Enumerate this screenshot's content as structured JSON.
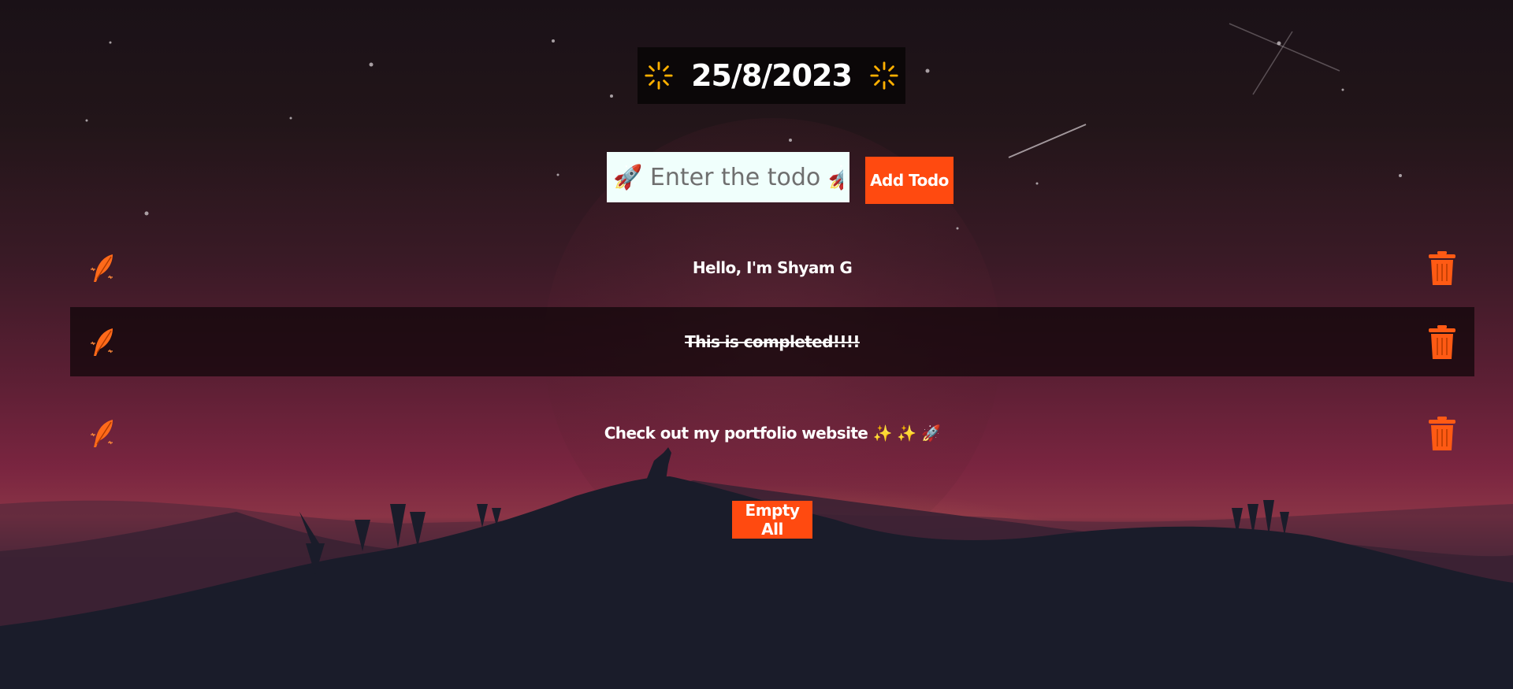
{
  "header": {
    "date": "25/8/2023",
    "left_icon": "sparkle-icon",
    "right_icon": "sparkle-icon"
  },
  "input": {
    "placeholder": "🚀 Enter the todo 🚀",
    "value": ""
  },
  "buttons": {
    "add_label": "Add Todo",
    "empty_label": "Empty All"
  },
  "todos": [
    {
      "text": "Hello, I'm Shyam G",
      "completed": false,
      "edit_icon": "feather-icon",
      "delete_icon": "trash-icon"
    },
    {
      "text": "This is completed!!!!",
      "completed": true,
      "edit_icon": "feather-icon",
      "delete_icon": "trash-icon"
    },
    {
      "text": "Check out my portfolio website ✨ ✨ 🚀",
      "completed": false,
      "edit_icon": "feather-icon",
      "delete_icon": "trash-icon"
    }
  ],
  "colors": {
    "accent": "#ff4a10",
    "input_bg": "#f0fffc",
    "date_bg": "#0b0708",
    "trash": "#ff5a14"
  }
}
